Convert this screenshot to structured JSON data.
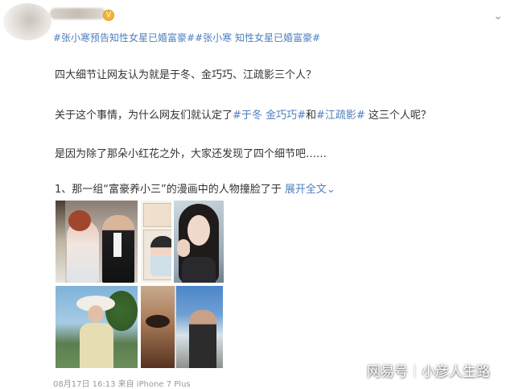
{
  "post": {
    "verified_badge": "V",
    "topic_line": "#张小寒预告知性女星已婚富豪##张小寒 知性女星已婚富豪#",
    "para1": "四大细节让网友认为就是于冬、金巧巧、江疏影三个人？",
    "para2_prefix": "关于这个事情，为什么网友们就认定了",
    "para2_links": [
      "#于冬",
      "金巧巧#",
      "#江疏影#"
    ],
    "para2_joiner_1": " ",
    "para2_joiner_2": "和",
    "para2_suffix": " 这三个人呢？",
    "para3": "是因为除了那朵小红花之外，大家还发现了四个细节吧……",
    "para4": "1、那一组“富豪养小三”的漫画中的人物撞脸了于",
    "expand_label": "展开全文",
    "expand_icon": "chevron-down",
    "timestamp": "08月17日 16:13  来自 iPhone 7 Plus"
  },
  "watermark": {
    "left": "网易号",
    "right": "小彦人生路"
  },
  "colors": {
    "link": "#4d7fbf",
    "text": "#333333"
  }
}
